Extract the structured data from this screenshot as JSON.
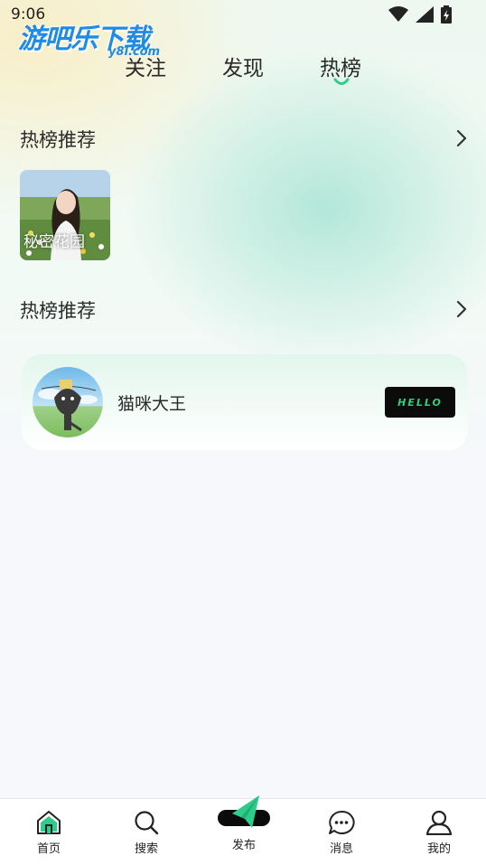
{
  "status_bar": {
    "time": "9:06"
  },
  "watermark": {
    "main": "游吧乐下载",
    "sub": "y8l.com"
  },
  "tabs": [
    {
      "label": "关注",
      "active": false
    },
    {
      "label": "发现",
      "active": false
    },
    {
      "label": "热榜",
      "active": true
    }
  ],
  "sections": [
    {
      "title": "热榜推荐",
      "card_caption": "秘密花园"
    },
    {
      "title": "热榜推荐"
    }
  ],
  "user_card": {
    "name": "猫咪大王",
    "badge": "HELLO"
  },
  "bottom_nav": [
    {
      "label": "首页",
      "icon": "home-icon"
    },
    {
      "label": "搜索",
      "icon": "search-icon"
    },
    {
      "label": "发布",
      "icon": "send-icon"
    },
    {
      "label": "消息",
      "icon": "message-icon"
    },
    {
      "label": "我的",
      "icon": "user-icon"
    }
  ],
  "colors": {
    "accent": "#2ecc8a",
    "text": "#2a2a2a",
    "watermark": "#1e8be6"
  }
}
